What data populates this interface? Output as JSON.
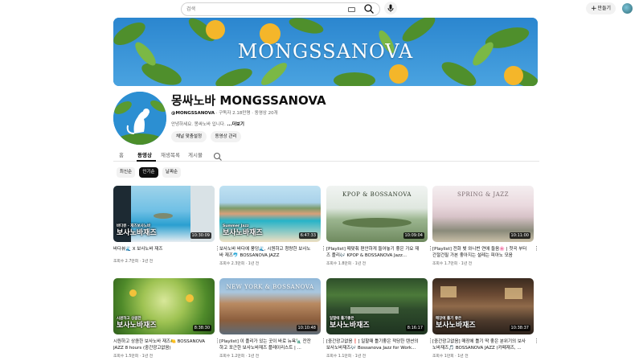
{
  "topbar": {
    "search_placeholder": "검색",
    "create_label": "만들기"
  },
  "banner": {
    "title": "MONGSSANOVA"
  },
  "channel": {
    "name": "몽싸노바 MONGSSANOVA",
    "handle": "@MONGSSANOVA",
    "meta": "· 구독자 2.18만명 · 동영상 20개",
    "description": "안녕하세요. 몽싸노바 입니다.",
    "more_label": "...더보기",
    "buttons": [
      "채널 맞춤설정",
      "동영상 관리"
    ]
  },
  "tabs": [
    "홈",
    "동영상",
    "재생목록",
    "게시물"
  ],
  "active_tab": "동영상",
  "filters": [
    "최신순",
    "인기순",
    "날짜순"
  ],
  "active_filter": "인기순",
  "videos": [
    {
      "title": "바다뷰🌊 X 보사노바 재즈",
      "meta": "조회수 2.7만회 · 1년 전",
      "duration": "10:30:09",
      "overlay": "보사노바재즈",
      "overlay_small": "바다뷰 · 재즈보사노바"
    },
    {
      "title": "보사노바 바다에 풍덩🌊, 시원하고 청량한 보사노바 재즈🐬 BOSSANOVA JAZZ",
      "meta": "조회수 2.3만회 · 1년 전",
      "duration": "6:47:33",
      "overlay": "보사노바재즈",
      "overlay_small": "Summer Jazz"
    },
    {
      "title": "[Playlist] 때맞춰 편안하게 들어놓기 좋은 가요 재즈 플리🎶 KPOP & BOSSANOVA Jazz...",
      "meta": "조회수 1.8만회 · 1년 전",
      "duration": "10:09:04",
      "thumb_title": "KPOP & BOSSANOVA"
    },
    {
      "title": "[Playlist] 전화 벚 와니번 연애 들음🌸 | 첫곡 부터 간절건필 가본 좋아지는 설레는 피아노 모음",
      "meta": "조회수 1.7만회 · 1년 전",
      "duration": "10:11:00",
      "thumb_title": "SPRING & JAZZ"
    },
    {
      "title": "시원하고 상큼한 보사노바 재즈🍋 BOSSANOVA JAZZ 8 hours (중간광고없음)",
      "meta": "조회수 1.5만회 · 1년 전",
      "duration": "8:38:30",
      "overlay": "보사노바재즈",
      "overlay_small": "시원하고 상큼한"
    },
    {
      "title": "[Playlist] 이 플리가 있는 곳이 바로 뉴욕🗽 잔잔하고 포근한 보사노바재즈 플레이리스트 | ...",
      "meta": "조회수 1.2만회 · 1년 전",
      "duration": "10:10:48",
      "thumb_title": "NEW YORK & BOSSANOVA"
    },
    {
      "title": "[중간광고없음❗] 일할때 틀기좋은 적당한 텐션의 보사노바재즈🎶 Bossanova Jazz for Work...",
      "meta": "조회수 1.1만회 · 1년 전",
      "duration": "8:16:17",
      "overlay": "보사노바재즈",
      "overlay_small": "일할때 틀기좋은"
    },
    {
      "title": "[중간광고없음] 매장에 틀기 딱 좋은 분위기의 보사노바재즈🎵 BOSSANOVA JAZZ (카페재즈, ...",
      "meta": "조회수 1만회 · 1년 전",
      "duration": "10:38:37",
      "overlay": "보사노바재즈",
      "overlay_small": "매장에 틀기 좋은"
    }
  ]
}
